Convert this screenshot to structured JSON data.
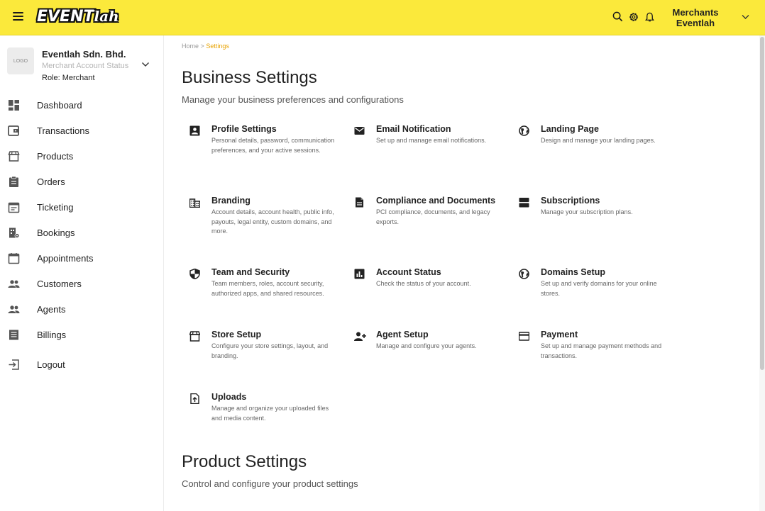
{
  "header": {
    "logo_main": "EVENT",
    "logo_script": "lah",
    "merchant_line1": "Merchants",
    "merchant_line2": "Eventlah",
    "icons": [
      "menu-icon",
      "search-icon",
      "gear-icon",
      "bell-icon",
      "chevron-down-icon"
    ],
    "accent_color": "#fbe93b"
  },
  "account": {
    "logo_label": "LOGO",
    "name": "Eventlah Sdn. Bhd.",
    "status": "Merchant Account Status",
    "role": "Role: Merchant"
  },
  "sidebar": {
    "items": [
      {
        "label": "Dashboard",
        "icon": "dashboard-icon"
      },
      {
        "label": "Transactions",
        "icon": "wallet-icon"
      },
      {
        "label": "Products",
        "icon": "store-icon"
      },
      {
        "label": "Orders",
        "icon": "clipboard-icon"
      },
      {
        "label": "Ticketing",
        "icon": "calendar-icon"
      },
      {
        "label": "Bookings",
        "icon": "building-gear-icon"
      },
      {
        "label": "Appointments",
        "icon": "calendar-blank-icon"
      },
      {
        "label": "Customers",
        "icon": "people-icon"
      },
      {
        "label": "Agents",
        "icon": "people-icon"
      },
      {
        "label": "Billings",
        "icon": "receipt-icon"
      },
      {
        "label": "Logout",
        "icon": "logout-icon"
      }
    ]
  },
  "breadcrumb": {
    "home": "Home",
    "separator": ">",
    "current": "Settings"
  },
  "business": {
    "title": "Business Settings",
    "subtitle": "Manage your business preferences and configurations",
    "cards": [
      {
        "title": "Profile Settings",
        "desc": "Personal details, password, communication preferences, and your active sessions.",
        "icon": "account-box-icon"
      },
      {
        "title": "Email Notification",
        "desc": "Set up and manage email notifications.",
        "icon": "email-icon"
      },
      {
        "title": "Landing Page",
        "desc": "Design and manage your landing pages.",
        "icon": "globe-icon"
      },
      {
        "title": "Branding",
        "desc": "Account details, account health, public info, payouts, legal entity, custom domains, and more.",
        "icon": "building-icon"
      },
      {
        "title": "Compliance and Documents",
        "desc": "PCI compliance, documents, and legacy exports.",
        "icon": "document-icon"
      },
      {
        "title": "Subscriptions",
        "desc": "Manage your subscription plans.",
        "icon": "subscriptions-icon"
      },
      {
        "title": "Team and Security",
        "desc": "Team members, roles, account security, authorized apps, and shared resources.",
        "icon": "shield-icon"
      },
      {
        "title": "Account Status",
        "desc": "Check the status of your account.",
        "icon": "bar-chart-icon"
      },
      {
        "title": "Domains Setup",
        "desc": "Set up and verify domains for your online stores.",
        "icon": "globe-icon"
      },
      {
        "title": "Store Setup",
        "desc": "Configure your store settings, layout, and branding.",
        "icon": "store-icon"
      },
      {
        "title": "Agent Setup",
        "desc": "Manage and configure your agents.",
        "icon": "person-add-icon"
      },
      {
        "title": "Payment",
        "desc": "Set up and manage payment methods and transactions.",
        "icon": "credit-card-icon"
      },
      {
        "title": "Uploads",
        "desc": "Manage and organize your uploaded files and media content.",
        "icon": "file-upload-icon"
      }
    ]
  },
  "product": {
    "title": "Product Settings",
    "subtitle": "Control and configure your product settings"
  }
}
